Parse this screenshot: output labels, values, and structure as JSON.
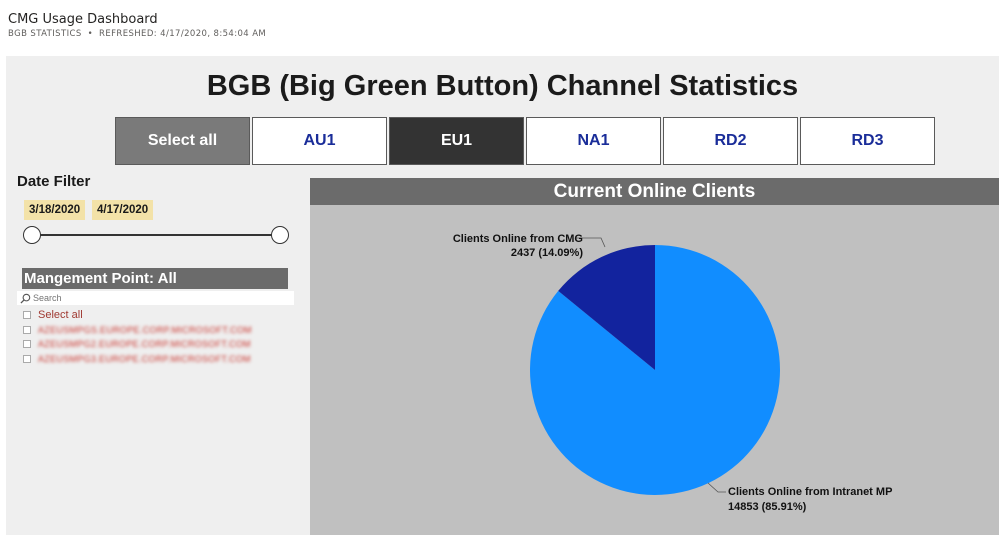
{
  "header": {
    "app_title": "CMG Usage Dashboard",
    "section": "BGB STATISTICS",
    "separator": "•",
    "refreshed": "REFRESHED: 4/17/2020, 8:54:04 AM"
  },
  "dashboard": {
    "title": "BGB (Big Green Button) Channel Statistics"
  },
  "tabs": [
    {
      "label": "Select all",
      "state": "select-all"
    },
    {
      "label": "AU1",
      "state": "normal"
    },
    {
      "label": "EU1",
      "state": "active"
    },
    {
      "label": "NA1",
      "state": "normal"
    },
    {
      "label": "RD2",
      "state": "normal"
    },
    {
      "label": "RD3",
      "state": "normal"
    }
  ],
  "date_filter": {
    "title": "Date Filter",
    "start": "3/18/2020",
    "end": "4/17/2020"
  },
  "management_point": {
    "title": "Mangement Point: All",
    "search_placeholder": "Search",
    "select_all_label": "Select all",
    "items": [
      "AZEUSMPGS.EUROPE.CORP.MICROSOFT.COM",
      "AZEUSMPG2.EUROPE.CORP.MICROSOFT.COM",
      "AZEUSMPG3.EUROPE.CORP.MICROSOFT.COM"
    ]
  },
  "colors": {
    "intranet": "#118dff",
    "cmg": "#12239e",
    "tab_active": "#333333",
    "tab_select_all": "#7a7a7a",
    "tab_text": "#1a2d99",
    "chip": "#f3e2a8"
  },
  "chart_data": {
    "type": "pie",
    "title": "Current Online Clients",
    "slices": [
      {
        "name": "Clients Online from CMG",
        "value": 2437,
        "percent": "14.09%",
        "value_label": "2437 (14.09%)"
      },
      {
        "name": "Clients Online from Intranet MP",
        "value": 14853,
        "percent": "85.91%",
        "value_label": "14853 (85.91%)"
      }
    ]
  }
}
